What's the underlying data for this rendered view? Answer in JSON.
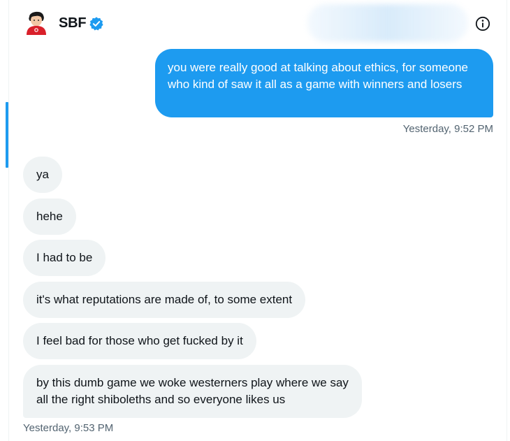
{
  "header": {
    "name": "SBF",
    "avatar_icon": "person-avatar-icon",
    "verified_icon": "verified-badge-icon",
    "info_icon": "info-icon"
  },
  "colors": {
    "outgoing_bubble": "#1d9bf0",
    "incoming_bubble": "#eff3f4",
    "timestamp": "#536471",
    "verified": "#1d9bf0"
  },
  "messages": {
    "outgoing": {
      "text": "you were really good at talking about ethics, for someone who kind of saw it all as a game with winners and losers",
      "timestamp": "Yesterday, 9:52 PM"
    },
    "incoming": [
      {
        "text": "ya"
      },
      {
        "text": "hehe"
      },
      {
        "text": "I had to be"
      },
      {
        "text": "it's what reputations are made of, to some extent"
      },
      {
        "text": "I feel bad for those who get fucked by it"
      },
      {
        "text": "by this dumb game we woke westerners play where we say all the right shiboleths and so everyone likes us"
      }
    ],
    "incoming_timestamp": "Yesterday, 9:53 PM"
  }
}
